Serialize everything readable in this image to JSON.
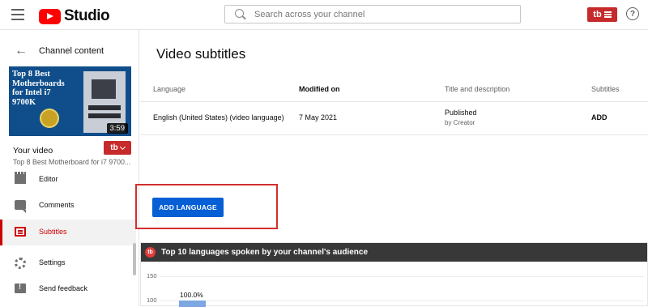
{
  "header": {
    "logo_text": "Studio",
    "search_placeholder": "Search across your channel",
    "extension_badge": "tb",
    "help_glyph": "?"
  },
  "sidebar": {
    "back_label": "Channel content",
    "thumbnail": {
      "title_text": "Top 8 Best Motherboards for Intel i7 9700K",
      "duration": "3:59"
    },
    "your_video_label": "Your video",
    "video_title": "Top 8 Best Motherboard for i7 9700...",
    "extension_badge": "tb",
    "nav_items": [
      {
        "label": "Editor",
        "icon": "film-icon",
        "active": false
      },
      {
        "label": "Comments",
        "icon": "comment-icon",
        "active": false
      },
      {
        "label": "Subtitles",
        "icon": "subtitles-icon",
        "active": true
      },
      {
        "label": "Settings",
        "icon": "gear-icon",
        "active": false
      },
      {
        "label": "Send feedback",
        "icon": "feedback-icon",
        "active": false
      }
    ]
  },
  "main": {
    "page_title": "Video subtitles",
    "table": {
      "headers": [
        "Language",
        "Modified on",
        "Title and description",
        "Subtitles"
      ],
      "rows": [
        {
          "language": "English (United States) (video language)",
          "modified_on": "7 May 2021",
          "status": "Published",
          "status_sub": "by Creator",
          "subtitles_action": "ADD"
        }
      ]
    },
    "add_language_button": "ADD LANGUAGE",
    "languages_panel": {
      "logo_glyph": "tb",
      "title": "Top 10 languages spoken by your channel's audience",
      "y_ticks": [
        "150",
        "100"
      ],
      "bar_label": "100.0%",
      "bar_value": 100
    }
  },
  "colors": {
    "brand_red": "#ff0000",
    "accent_blue": "#065fd4",
    "active_red": "#cc0000",
    "extension_red": "#c72a2a",
    "highlight_red": "#d32f2f"
  }
}
